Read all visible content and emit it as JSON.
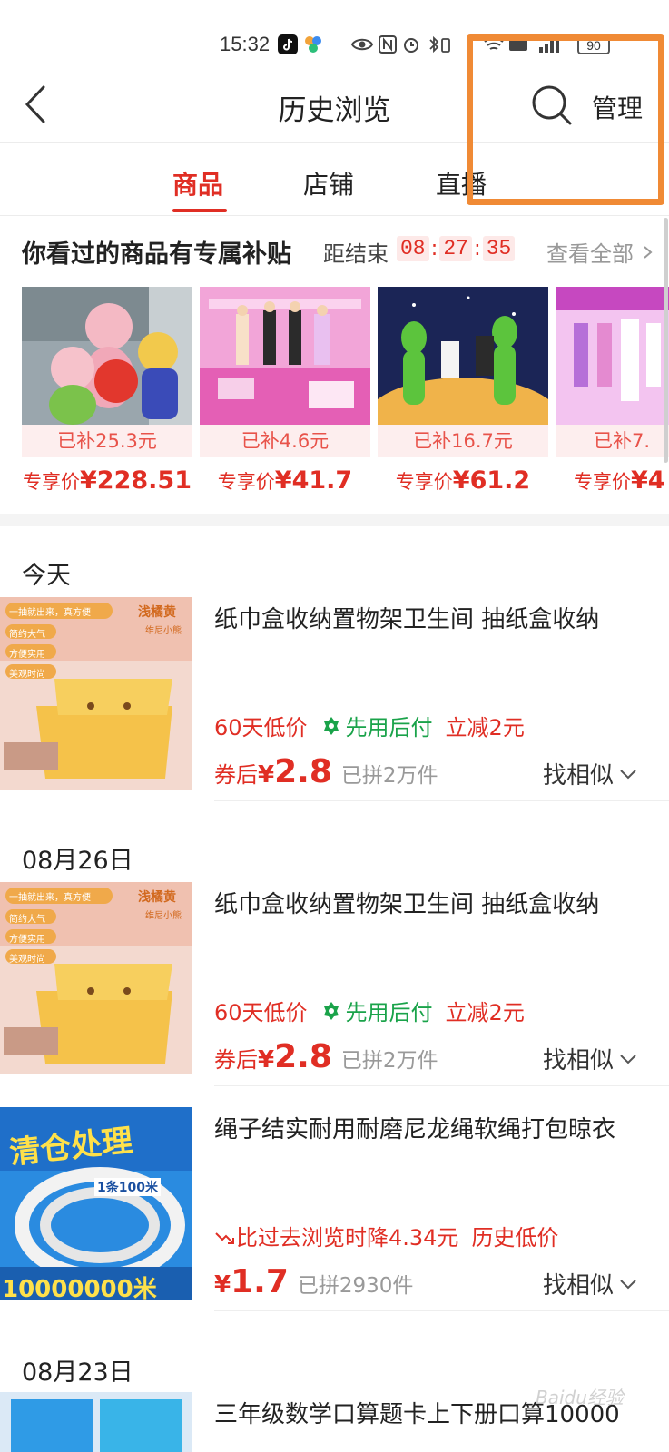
{
  "status_bar": {
    "time": "15:32",
    "battery": "90"
  },
  "nav": {
    "title": "历史浏览",
    "manage_label": "管理"
  },
  "tabs": [
    {
      "label": "商品",
      "active": true
    },
    {
      "label": "店铺",
      "active": false
    },
    {
      "label": "直播",
      "active": false
    }
  ],
  "subsidy": {
    "heading": "你看过的商品有专属补贴",
    "ends_label": "距结束",
    "timer": {
      "h": "08",
      "m": "27",
      "s": "35"
    },
    "view_all": "查看全部",
    "products": [
      {
        "subsidy": "已补25.3元",
        "price_label": "专享价",
        "price": "¥228.51"
      },
      {
        "subsidy": "已补4.6元",
        "price_label": "专享价",
        "price": "¥41.7"
      },
      {
        "subsidy": "已补16.7元",
        "price_label": "专享价",
        "price": "¥61.2"
      },
      {
        "subsidy": "已补7.",
        "price_label": "专享价",
        "price": "¥4"
      }
    ]
  },
  "history": {
    "groups": [
      {
        "date": "今天"
      },
      {
        "date": "08月26日"
      },
      {
        "date": "08月23日"
      }
    ],
    "items": [
      {
        "title": "纸巾盒收纳置物架卫生间 抽纸盒收纳",
        "tag_low": "60天低价",
        "tag_pay": "先用后付",
        "tag_discount": "立减2元",
        "price_prefix": "券后",
        "currency": "¥",
        "price": "2.8",
        "sold": "已拼2万件",
        "similar": "找相似",
        "thumb_text": {
          "brand": "浅橘黄",
          "sub": "维尼小熊",
          "b1": "一抽就出来，真方便",
          "b2": "简约大气",
          "b3": "方便实用",
          "b4": "美观时尚"
        }
      },
      {
        "title": "纸巾盒收纳置物架卫生间 抽纸盒收纳",
        "tag_low": "60天低价",
        "tag_pay": "先用后付",
        "tag_discount": "立减2元",
        "price_prefix": "券后",
        "currency": "¥",
        "price": "2.8",
        "sold": "已拼2万件",
        "similar": "找相似",
        "thumb_text": {
          "brand": "浅橘黄",
          "sub": "维尼小熊",
          "b1": "一抽就出来，真方便",
          "b2": "简约大气",
          "b3": "方便实用",
          "b4": "美观时尚"
        }
      },
      {
        "title": "绳子结实耐用耐磨尼龙绳软绳打包晾衣",
        "tag_drop": "比过去浏览时降4.34元",
        "tag_hist": "历史低价",
        "currency": "¥",
        "price": "1.7",
        "sold": "已拼2930件",
        "similar": "找相似",
        "thumb_text": {
          "banner": "清仓处理",
          "len": "1条100米",
          "big": "10000000米"
        }
      },
      {
        "title": "三年级数学口算题卡上下册口算10000"
      }
    ]
  },
  "watermark": "Baidu经验",
  "colors": {
    "accent": "#e02e24",
    "green": "#1aa34a",
    "highlight": "#f08a35"
  }
}
